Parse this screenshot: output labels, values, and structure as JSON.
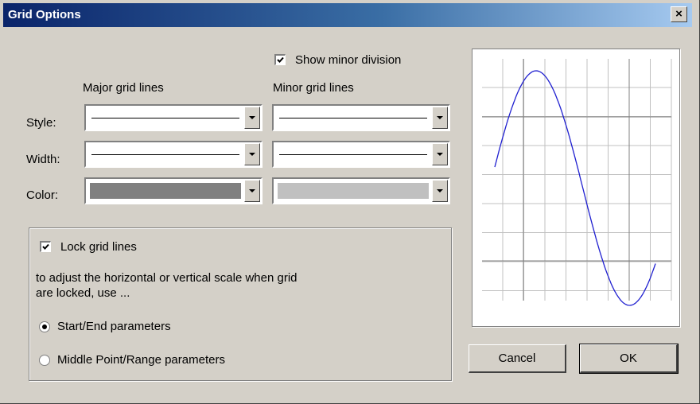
{
  "window": {
    "title": "Grid Options",
    "close_label": "×"
  },
  "show_minor": {
    "label": "Show minor division",
    "checked": true
  },
  "headers": {
    "major": "Major grid lines",
    "minor": "Minor grid lines"
  },
  "rows": {
    "style": "Style:",
    "width": "Width:",
    "color": "Color:"
  },
  "colors": {
    "major_color": "#808080",
    "minor_color": "#c0c0c0",
    "curve": "#2020d0"
  },
  "lock": {
    "label": "Lock grid lines",
    "checked": true,
    "help_line1": "to adjust the horizontal or vertical scale when grid",
    "help_line2": "are locked, use ...",
    "option_start_end": "Start/End parameters",
    "option_middle_range": "Middle Point/Range parameters",
    "selected": "start_end"
  },
  "buttons": {
    "cancel": "Cancel",
    "ok": "OK"
  }
}
